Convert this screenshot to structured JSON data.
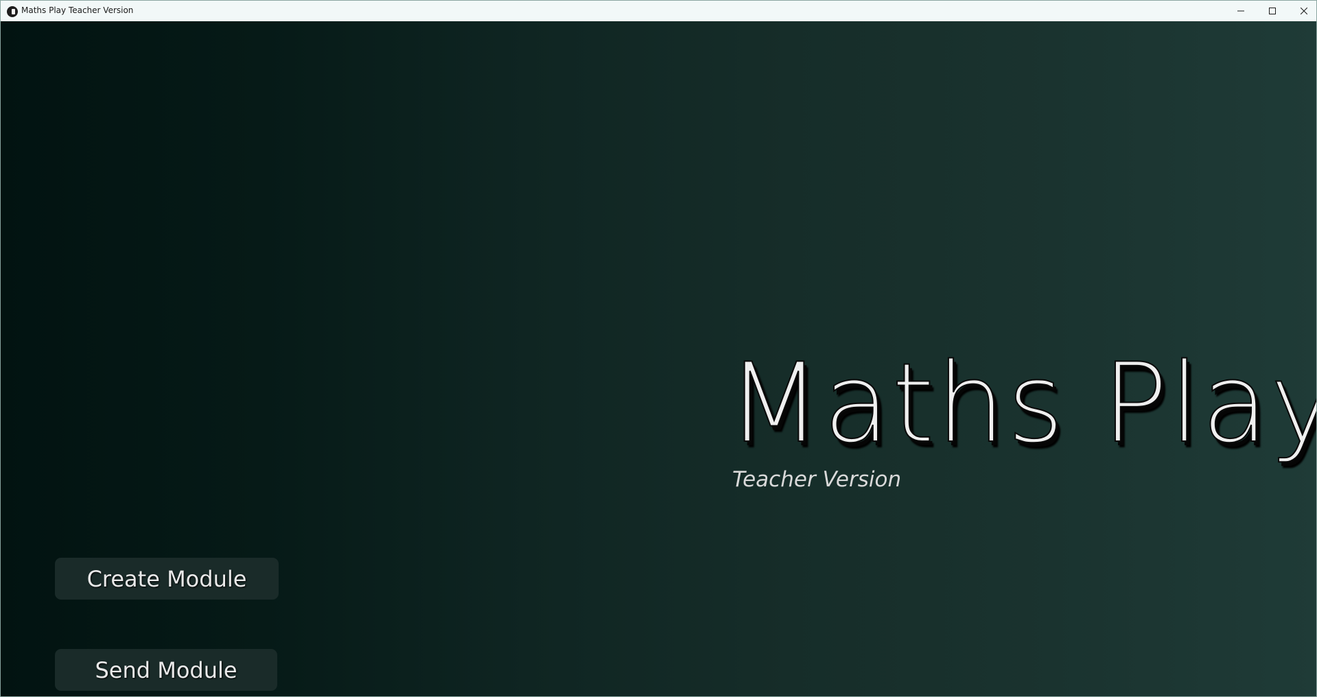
{
  "window": {
    "title": "Maths Play Teacher Version",
    "controls": {
      "minimize_icon": "minimize-icon",
      "maximize_icon": "maximize-icon",
      "close_icon": "close-icon"
    }
  },
  "hero": {
    "title": "Maths Play",
    "subtitle": "Teacher Version"
  },
  "menu": {
    "create_label": "Create Module",
    "send_label": "Send Module"
  },
  "colors": {
    "background_left": "#021311",
    "background_right": "#1f3b37",
    "button_bg": "#1a2b29",
    "title_text": "#efefef"
  }
}
